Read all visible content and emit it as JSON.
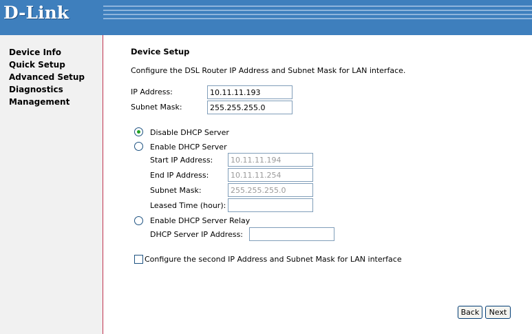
{
  "header": {
    "logo_text": "D-Link"
  },
  "sidebar": {
    "items": [
      {
        "label": "Device Info"
      },
      {
        "label": "Quick Setup"
      },
      {
        "label": "Advanced Setup"
      },
      {
        "label": "Diagnostics"
      },
      {
        "label": "Management"
      }
    ]
  },
  "main": {
    "title": "Device Setup",
    "description": "Configure the DSL Router IP Address and Subnet Mask for LAN interface.",
    "ip_address": {
      "label": "IP Address:",
      "value": "10.11.11.193"
    },
    "subnet_mask": {
      "label": "Subnet Mask:",
      "value": "255.255.255.0"
    },
    "dhcp": {
      "disable_label": "Disable DHCP Server",
      "enable_label": "Enable DHCP Server",
      "selected": "disable",
      "start_ip": {
        "label": "Start IP Address:",
        "value": "10.11.11.194"
      },
      "end_ip": {
        "label": "End IP Address:",
        "value": "10.11.11.254"
      },
      "subnet_mask": {
        "label": "Subnet Mask:",
        "value": "255.255.255.0"
      },
      "leased_time": {
        "label": "Leased Time (hour):",
        "value": ""
      },
      "relay_label": "Enable DHCP Server Relay",
      "relay_ip": {
        "label": "DHCP Server IP Address:",
        "value": ""
      }
    },
    "second_ip": {
      "label": "Configure the second IP Address and Subnet Mask for LAN interface",
      "checked": false
    },
    "buttons": {
      "back": "Back",
      "next": "Next"
    }
  }
}
